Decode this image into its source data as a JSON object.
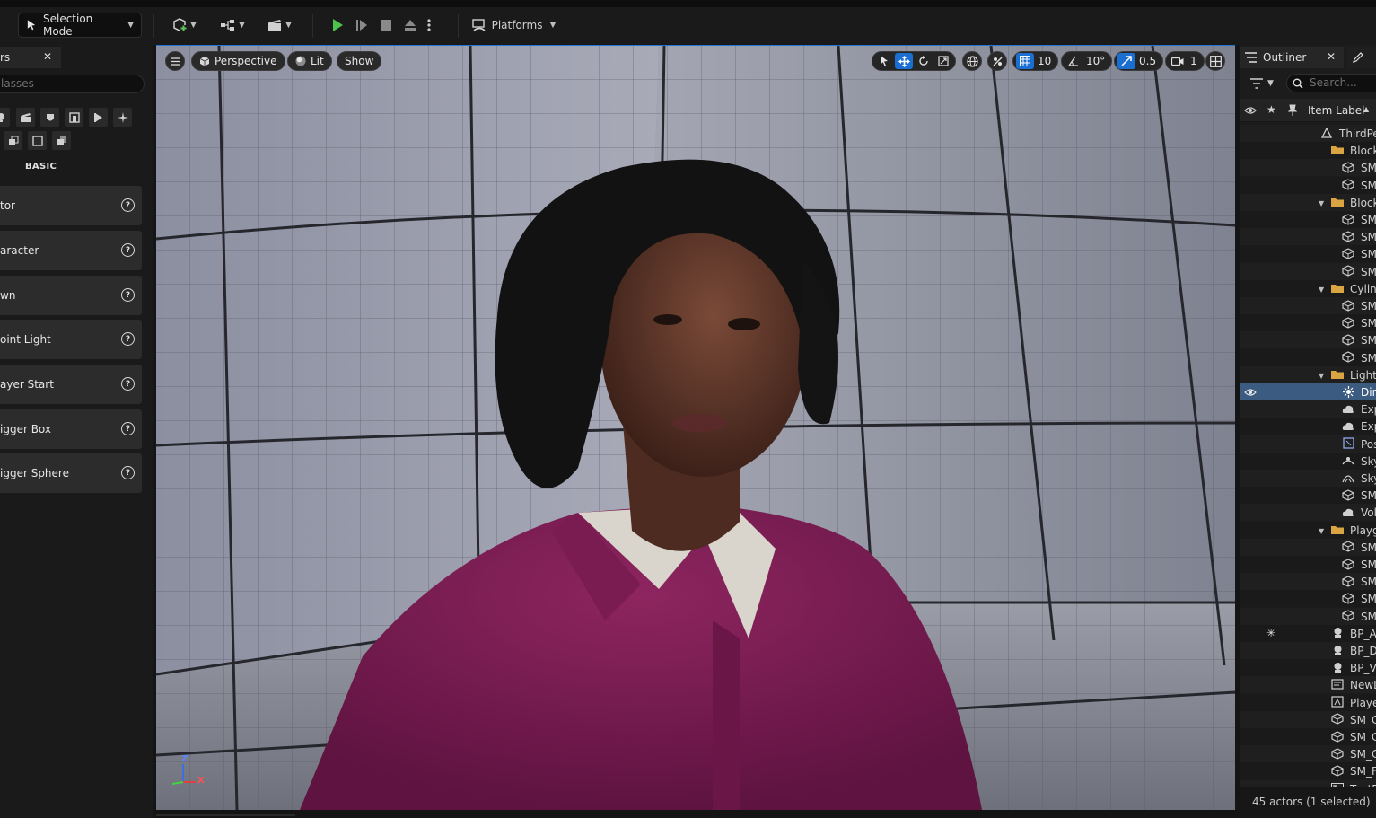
{
  "toolbar": {
    "selection_mode_label": "Selection Mode",
    "platforms_label": "Platforms"
  },
  "left_panel": {
    "tab_label": "rs",
    "search_placeholder": "lasses",
    "category_label": "BASIC",
    "items": [
      {
        "label": "tor"
      },
      {
        "label": "aracter"
      },
      {
        "label": "wn"
      },
      {
        "label": "oint Light"
      },
      {
        "label": "ayer Start"
      },
      {
        "label": "igger Box"
      },
      {
        "label": "igger Sphere"
      }
    ]
  },
  "viewport": {
    "perspective_label": "Perspective",
    "lit_label": "Lit",
    "show_label": "Show",
    "grid_snap_value": "10",
    "rotation_snap_value": "10°",
    "scale_snap_value": "0.5",
    "camera_speed_value": "1",
    "axis_labels": {
      "z": "Z",
      "x": "X"
    }
  },
  "outliner": {
    "tab_label": "Outliner",
    "search_placeholder": "Search...",
    "column_label": "Item Label",
    "rows": [
      {
        "label": "ThirdPe",
        "icon": "level-icon",
        "indent": 90,
        "arrow": false
      },
      {
        "label": "Block",
        "icon": "folder-icon",
        "indent": 102,
        "arrow": false
      },
      {
        "label": "SM",
        "icon": "mesh-icon",
        "indent": 114,
        "arrow": false
      },
      {
        "label": "SM",
        "icon": "mesh-icon",
        "indent": 114,
        "arrow": false
      },
      {
        "label": "Block",
        "icon": "folder-icon",
        "indent": 102,
        "arrow": true
      },
      {
        "label": "SM",
        "icon": "mesh-icon",
        "indent": 114,
        "arrow": false
      },
      {
        "label": "SM",
        "icon": "mesh-icon",
        "indent": 114,
        "arrow": false
      },
      {
        "label": "SM",
        "icon": "mesh-icon",
        "indent": 114,
        "arrow": false
      },
      {
        "label": "SM",
        "icon": "mesh-icon",
        "indent": 114,
        "arrow": false
      },
      {
        "label": "Cylin",
        "icon": "folder-icon",
        "indent": 102,
        "arrow": true
      },
      {
        "label": "SM",
        "icon": "mesh-icon",
        "indent": 114,
        "arrow": false
      },
      {
        "label": "SM",
        "icon": "mesh-icon",
        "indent": 114,
        "arrow": false
      },
      {
        "label": "SM",
        "icon": "mesh-icon",
        "indent": 114,
        "arrow": false
      },
      {
        "label": "SM",
        "icon": "mesh-icon",
        "indent": 114,
        "arrow": false
      },
      {
        "label": "Lighti",
        "icon": "folder-icon",
        "indent": 102,
        "arrow": true
      },
      {
        "label": "Dire",
        "icon": "light-icon",
        "indent": 114,
        "arrow": false,
        "selected": true
      },
      {
        "label": "Exp",
        "icon": "cloud-icon",
        "indent": 114,
        "arrow": false
      },
      {
        "label": "Exp",
        "icon": "cloud-icon",
        "indent": 114,
        "arrow": false
      },
      {
        "label": "Pos",
        "icon": "volume-icon",
        "indent": 114,
        "arrow": false
      },
      {
        "label": "Sky",
        "icon": "skylight-icon",
        "indent": 114,
        "arrow": false
      },
      {
        "label": "Sky",
        "icon": "skyatmo-icon",
        "indent": 114,
        "arrow": false
      },
      {
        "label": "SM",
        "icon": "mesh-icon",
        "indent": 114,
        "arrow": false
      },
      {
        "label": "Vol",
        "icon": "cloud-icon",
        "indent": 114,
        "arrow": false
      },
      {
        "label": "Playg",
        "icon": "folder-icon",
        "indent": 102,
        "arrow": true
      },
      {
        "label": "SM",
        "icon": "mesh-icon",
        "indent": 114,
        "arrow": false
      },
      {
        "label": "SM",
        "icon": "mesh-icon",
        "indent": 114,
        "arrow": false
      },
      {
        "label": "SM",
        "icon": "mesh-icon",
        "indent": 114,
        "arrow": false
      },
      {
        "label": "SM",
        "icon": "mesh-icon",
        "indent": 114,
        "arrow": false
      },
      {
        "label": "SM",
        "icon": "mesh-icon",
        "indent": 114,
        "arrow": false
      },
      {
        "label": "BP_A",
        "icon": "blueprint-icon",
        "indent": 102,
        "arrow": false,
        "starred": true
      },
      {
        "label": "BP_D",
        "icon": "blueprint-icon",
        "indent": 102,
        "arrow": false
      },
      {
        "label": "BP_V",
        "icon": "blueprint-icon",
        "indent": 102,
        "arrow": false
      },
      {
        "label": "NewL",
        "icon": "sequence-icon",
        "indent": 102,
        "arrow": false
      },
      {
        "label": "Playe",
        "icon": "playerstart-icon",
        "indent": 102,
        "arrow": false
      },
      {
        "label": "SM_C",
        "icon": "mesh-icon",
        "indent": 102,
        "arrow": false
      },
      {
        "label": "SM_C",
        "icon": "mesh-icon",
        "indent": 102,
        "arrow": false
      },
      {
        "label": "SM_C",
        "icon": "mesh-icon",
        "indent": 102,
        "arrow": false
      },
      {
        "label": "SM_F",
        "icon": "mesh-icon",
        "indent": 102,
        "arrow": false
      },
      {
        "label": "TextF",
        "icon": "text-icon",
        "indent": 102,
        "arrow": false
      }
    ],
    "footer_label": "45 actors (1 selected)"
  },
  "colors": {
    "accent": "#1c78d4",
    "play_green": "#4ec24e",
    "folder": "#d9a441",
    "selection": "#3c5b80"
  }
}
